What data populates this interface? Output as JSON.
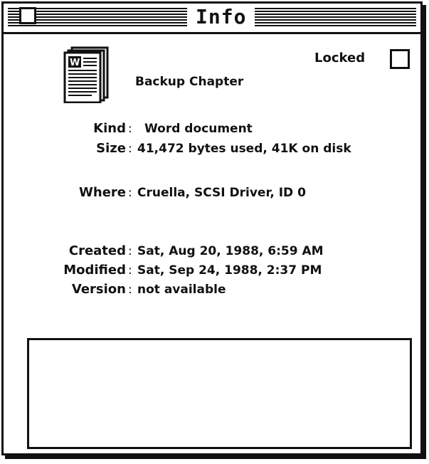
{
  "window": {
    "title": "Info"
  },
  "file": {
    "name": "Backup Chapter",
    "icon": "word-document-icon"
  },
  "locked": {
    "label": "Locked",
    "checked": false
  },
  "info": {
    "kind_label": "Kind",
    "kind_value": "Word document",
    "size_label": "Size",
    "size_value": "41,472 bytes used, 41K on disk",
    "where_label": "Where",
    "where_value": "Cruella, SCSI Driver, ID 0",
    "created_label": "Created",
    "created_value": "Sat, Aug 20, 1988, 6:59 AM",
    "modified_label": "Modified",
    "modified_value": "Sat, Sep 24, 1988, 2:37 PM",
    "version_label": "Version",
    "version_value": "not available"
  },
  "comments": {
    "value": ""
  }
}
